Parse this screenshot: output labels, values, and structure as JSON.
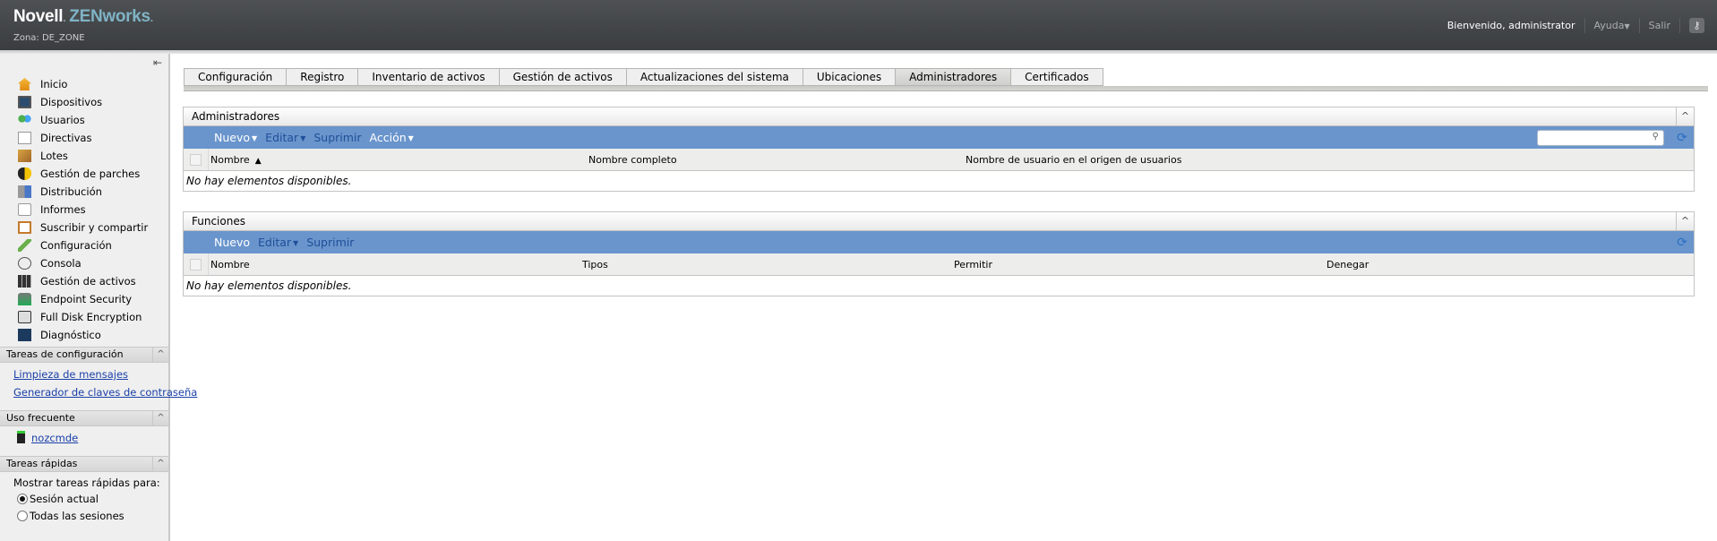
{
  "header": {
    "brand_novell": "Novell",
    "brand_dot": ".",
    "brand_product": "ZENworks",
    "zone_label": "Zona: DE_ZONE",
    "welcome": "Bienvenido, administrator",
    "help_label": "Ayuda",
    "logout_label": "Salir",
    "key_icon": "key-icon"
  },
  "sidebar": {
    "collapse_icon": "collapse-left-icon",
    "nav_items": [
      {
        "label": "Inicio",
        "icon": "home-icon"
      },
      {
        "label": "Dispositivos",
        "icon": "monitor-icon"
      },
      {
        "label": "Usuarios",
        "icon": "users-icon"
      },
      {
        "label": "Directivas",
        "icon": "policy-checklist-icon"
      },
      {
        "label": "Lotes",
        "icon": "bundle-box-icon"
      },
      {
        "label": "Gestión de parches",
        "icon": "shield-icon"
      },
      {
        "label": "Distribución",
        "icon": "distribution-icon"
      },
      {
        "label": "Informes",
        "icon": "report-icon"
      },
      {
        "label": "Suscribir y compartir",
        "icon": "subscribe-icon"
      },
      {
        "label": "Configuración",
        "icon": "wrench-icon"
      },
      {
        "label": "Consola",
        "icon": "gauge-icon"
      },
      {
        "label": "Gestión de activos",
        "icon": "asset-cabinet-icon"
      },
      {
        "label": "Endpoint Security",
        "icon": "lock-network-icon"
      },
      {
        "label": "Full Disk Encryption",
        "icon": "disk-icon"
      },
      {
        "label": "Diagnóstico",
        "icon": "diagnostic-pulse-icon"
      }
    ],
    "config_tasks": {
      "title": "Tareas de configuración",
      "links": [
        "Limpieza de mensajes",
        "Generador de claves de contraseña"
      ]
    },
    "frequent": {
      "title": "Uso frecuente",
      "items": [
        {
          "label": "nozcmde",
          "icon": "server-icon"
        }
      ]
    },
    "quick_tasks": {
      "title": "Tareas rápidas",
      "show_for_label": "Mostrar tareas rápidas para:",
      "options": [
        {
          "label": "Sesión actual",
          "checked": true
        },
        {
          "label": "Todas las sesiones",
          "checked": false
        }
      ]
    }
  },
  "tabs": [
    {
      "label": "Configuración",
      "active": false
    },
    {
      "label": "Registro",
      "active": false
    },
    {
      "label": "Inventario de activos",
      "active": false
    },
    {
      "label": "Gestión de activos",
      "active": false
    },
    {
      "label": "Actualizaciones del sistema",
      "active": false
    },
    {
      "label": "Ubicaciones",
      "active": false
    },
    {
      "label": "Administradores",
      "active": true
    },
    {
      "label": "Certificados",
      "active": false
    }
  ],
  "admins_panel": {
    "title": "Administradores",
    "toolbar": [
      {
        "label": "Nuevo",
        "dropdown": true,
        "enabled": true
      },
      {
        "label": "Editar",
        "dropdown": true,
        "enabled": false
      },
      {
        "label": "Suprimir",
        "dropdown": false,
        "enabled": false
      },
      {
        "label": "Acción",
        "dropdown": true,
        "enabled": true
      }
    ],
    "search_value": "",
    "columns": [
      "Nombre",
      "Nombre completo",
      "Nombre de usuario en el origen de usuarios"
    ],
    "sort_indicator": "▲",
    "empty_message": "No hay elementos disponibles."
  },
  "roles_panel": {
    "title": "Funciones",
    "toolbar": [
      {
        "label": "Nuevo",
        "dropdown": false,
        "enabled": true
      },
      {
        "label": "Editar",
        "dropdown": true,
        "enabled": false
      },
      {
        "label": "Suprimir",
        "dropdown": false,
        "enabled": false
      }
    ],
    "columns": [
      "Nombre",
      "Tipos",
      "Permitir",
      "Denegar"
    ],
    "empty_message": "No hay elementos disponibles."
  },
  "glyphs": {
    "caret": "▼",
    "chevron_up": "^",
    "search": "⚲",
    "refresh": "⟳",
    "key": "⚷",
    "collapse": "⇤"
  }
}
